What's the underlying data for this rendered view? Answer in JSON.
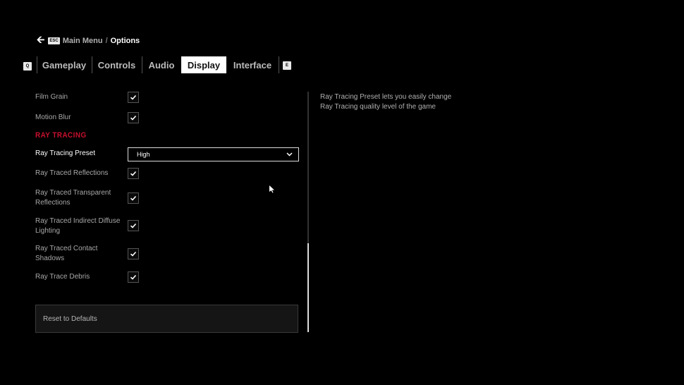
{
  "breadcrumb": {
    "back_key": "ESC",
    "parent": "Main Menu",
    "separator": "/",
    "current": "Options"
  },
  "tabs": {
    "prev_key": "Q",
    "next_key": "E",
    "items": [
      {
        "label": "Gameplay"
      },
      {
        "label": "Controls"
      },
      {
        "label": "Audio"
      },
      {
        "label": "Display",
        "active": true
      },
      {
        "label": "Interface"
      }
    ]
  },
  "settings": {
    "film_grain": {
      "label": "Film Grain",
      "checked": true
    },
    "motion_blur": {
      "label": "Motion Blur",
      "checked": true
    },
    "section": "RAY TRACING",
    "preset": {
      "label": "Ray Tracing Preset",
      "value": "High"
    },
    "reflections": {
      "label": "Ray Traced Reflections",
      "checked": true
    },
    "transparent": {
      "label": "Ray Traced Transparent Reflections",
      "checked": true
    },
    "indirect": {
      "label": "Ray Traced Indirect Diffuse Lighting",
      "checked": true
    },
    "contact": {
      "label": "Ray Traced Contact Shadows",
      "checked": true
    },
    "debris": {
      "label": "Ray Trace Debris",
      "checked": true
    }
  },
  "reset_label": "Reset to Defaults",
  "description": "Ray Tracing Preset lets you easily change Ray Tracing quality level of the game",
  "colors": {
    "accent": "#c8102e"
  }
}
